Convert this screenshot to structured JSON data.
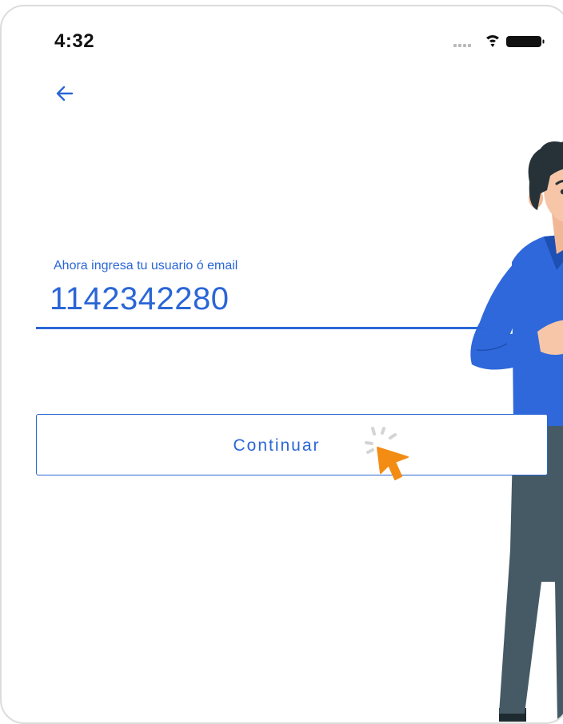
{
  "status_bar": {
    "time": "4:32",
    "icons": [
      "cellular-dots-icon",
      "wifi-icon",
      "battery-icon"
    ]
  },
  "nav": {
    "back_icon": "back-arrow-icon"
  },
  "login_field": {
    "label": "Ahora ingresa tu usuario ó email",
    "value": "1142342280"
  },
  "continue_button": {
    "label": "Continuar"
  },
  "colors": {
    "accent": "#2a66d6",
    "cursor": "#f28c13"
  }
}
